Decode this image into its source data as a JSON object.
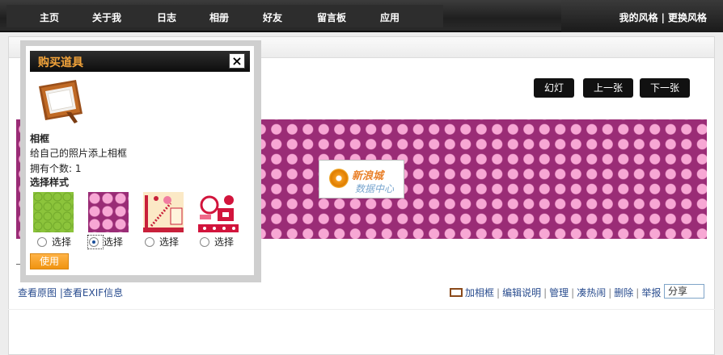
{
  "nav": {
    "items": [
      "主页",
      "关于我",
      "日志",
      "相册",
      "好友",
      "留言板",
      "应用"
    ],
    "right": {
      "my_style": "我的风格",
      "separator": "|",
      "change_style": "更换风格"
    }
  },
  "viewer": {
    "buttons": {
      "slideshow": "幻灯",
      "prev": "上一张",
      "next": "下一张"
    },
    "watermark": {
      "line1": "新浪城",
      "line2": "数据中心"
    }
  },
  "links": {
    "left": {
      "view_original": "查看原图",
      "separator": "|",
      "view_exif": "查看EXIF信息"
    },
    "right": [
      "加相框",
      "编辑说明",
      "管理",
      "凑热闹",
      "删除",
      "举报"
    ],
    "share": "分享"
  },
  "modal": {
    "title": "购买道具",
    "close": "×",
    "item_name": "相框",
    "item_desc": "给自己的照片添上相框",
    "owned_label": "拥有个数: 1",
    "choose_style": "选择样式",
    "options": [
      {
        "label": "选择",
        "selected": false
      },
      {
        "label": "选择",
        "selected": true
      },
      {
        "label": "选择",
        "selected": false
      },
      {
        "label": "选择",
        "selected": false
      }
    ],
    "use_button": "使用"
  },
  "colors": {
    "accent_orange": "#f09410",
    "photo_bg": "#9a2c76",
    "photo_dot": "#f7a7d4",
    "link_blue": "#2a4d8f"
  }
}
